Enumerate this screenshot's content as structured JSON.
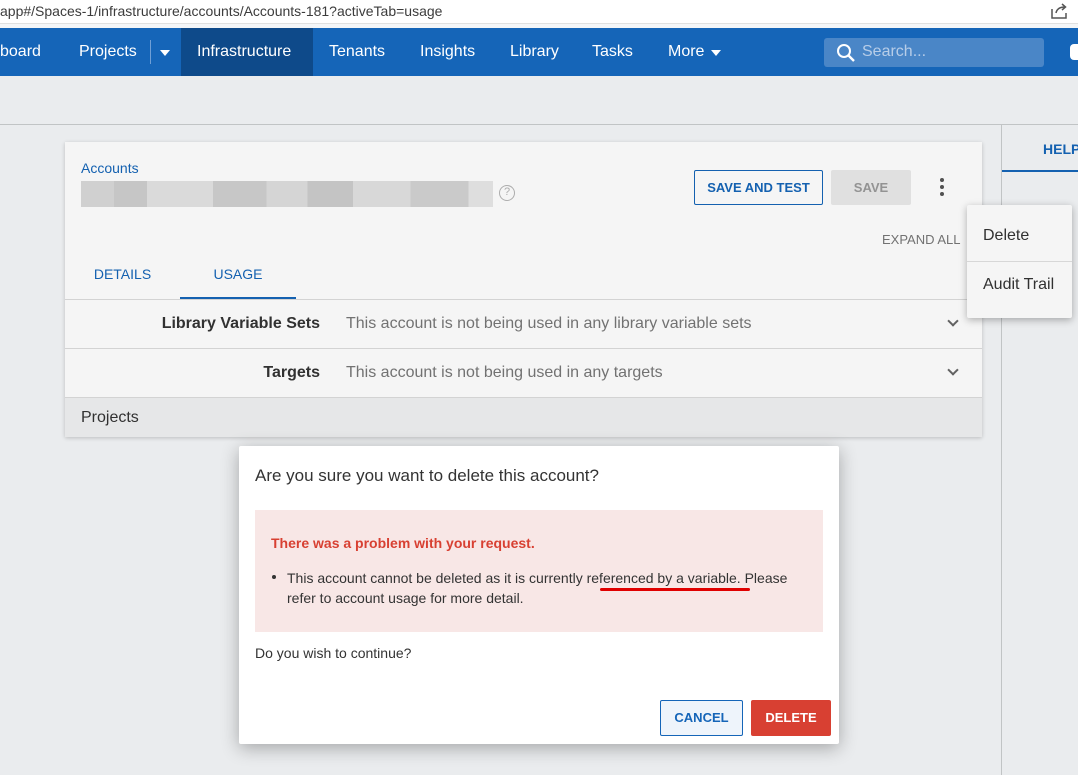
{
  "browser": {
    "url": "app#/Spaces-1/infrastructure/accounts/Accounts-181?activeTab=usage"
  },
  "nav": {
    "items": [
      {
        "label": "board"
      },
      {
        "label": "Projects"
      },
      {
        "label": "Infrastructure"
      },
      {
        "label": "Tenants"
      },
      {
        "label": "Insights"
      },
      {
        "label": "Library"
      },
      {
        "label": "Tasks"
      },
      {
        "label": "More"
      }
    ],
    "active": "Infrastructure",
    "search_placeholder": "Search...",
    "color": "#1565b8"
  },
  "help_panel": {
    "title": "HELP"
  },
  "account": {
    "breadcrumb": "Accounts",
    "actions": {
      "save_and_test": "SAVE AND TEST",
      "save": "SAVE",
      "expand_all": "EXPAND ALL"
    },
    "tabs": [
      {
        "label": "DETAILS"
      },
      {
        "label": "USAGE"
      }
    ],
    "active_tab": "USAGE",
    "usage": [
      {
        "label": "Library Variable Sets",
        "value": "This account is not being used in any library variable sets"
      },
      {
        "label": "Targets",
        "value": "This account is not being used in any targets"
      }
    ],
    "projects_label": "Projects"
  },
  "menu": {
    "items": [
      {
        "label": "Delete"
      },
      {
        "label": "Audit Trail"
      }
    ]
  },
  "dialog": {
    "title": "Are you sure you want to delete this account?",
    "error_title": "There was a problem with your request.",
    "error_message": "This account cannot be deleted as it is currently referenced by a variable. Please refer to account usage for more detail.",
    "question": "Do you wish to continue?",
    "cancel": "CANCEL",
    "delete": "DELETE",
    "error_color": "#d84032"
  }
}
